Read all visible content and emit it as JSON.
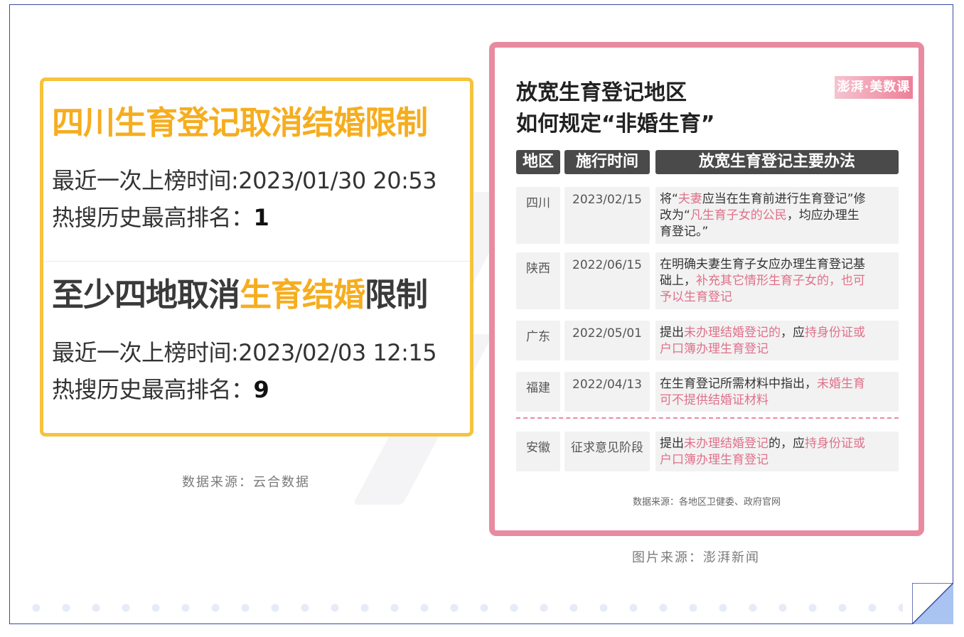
{
  "left_card": {
    "topics": [
      {
        "title_segments": [
          {
            "text": "四川生育登记取消结婚限制",
            "style": "orange"
          }
        ],
        "latest_time_label": "最近一次上榜时间:",
        "latest_time": "2023/01/30 20:53",
        "rank_label": "热搜历史最高排名：",
        "rank": "1"
      },
      {
        "title_segments": [
          {
            "text": "至少四地取消",
            "style": "dark"
          },
          {
            "text": "生育结婚",
            "style": "orange"
          },
          {
            "text": "限制",
            "style": "dark"
          }
        ],
        "latest_time_label": "最近一次上榜时间:",
        "latest_time": "2023/02/03 12:15",
        "rank_label": "热搜历史最高排名：",
        "rank": "9"
      }
    ],
    "caption": "数据来源：云合数据"
  },
  "right_card": {
    "title_line1": "放宽生育登记地区",
    "title_line2": "如何规定“非婚生育”",
    "brand": "澎湃·美数课",
    "headers": [
      "地区",
      "施行时间",
      "放宽生育登记主要办法"
    ],
    "rows": [
      {
        "region": "四川",
        "date": "2023/02/15",
        "lines": [
          [
            {
              "t": "将“",
              "p": false
            },
            {
              "t": "夫妻",
              "p": true
            },
            {
              "t": "应当在生育前进行生育登记”修",
              "p": false
            }
          ],
          [
            {
              "t": "改为“",
              "p": false
            },
            {
              "t": "凡生育子女的公民",
              "p": true
            },
            {
              "t": "，均应办理生",
              "p": false
            }
          ],
          [
            {
              "t": "育登记。”",
              "p": false
            }
          ]
        ]
      },
      {
        "region": "陕西",
        "date": "2022/06/15",
        "lines": [
          [
            {
              "t": "在明确夫妻生育子女应办理生育登记基",
              "p": false
            }
          ],
          [
            {
              "t": "础上，",
              "p": false
            },
            {
              "t": "补充其它情形生育子女的，也可",
              "p": true
            }
          ],
          [
            {
              "t": "予以生育登记",
              "p": true
            }
          ]
        ]
      },
      {
        "region": "广东",
        "date": "2022/05/01",
        "lines": [
          [
            {
              "t": "提出",
              "p": false
            },
            {
              "t": "未办理结婚登记的",
              "p": true
            },
            {
              "t": "，应",
              "p": false
            },
            {
              "t": "持身份证或",
              "p": true
            }
          ],
          [
            {
              "t": "户口簿办理生育登记",
              "p": true
            }
          ]
        ]
      },
      {
        "region": "福建",
        "date": "2022/04/13",
        "lines": [
          [
            {
              "t": "在生育登记所需材料中指出，",
              "p": false
            },
            {
              "t": "未婚生育",
              "p": true
            }
          ],
          [
            {
              "t": "可不提供结婚证材料",
              "p": true
            }
          ]
        ]
      },
      {
        "region": "安徽",
        "date": "征求意见阶段",
        "lines": [
          [
            {
              "t": "提出",
              "p": false
            },
            {
              "t": "未办理结婚登记",
              "p": true
            },
            {
              "t": "的，应",
              "p": false
            },
            {
              "t": "持身份证或",
              "p": true
            }
          ],
          [
            {
              "t": "户口簿办理生育登记",
              "p": true
            }
          ]
        ]
      }
    ],
    "source": "数据来源：各地区卫健委、政府官网",
    "caption": "图片来源：澎湃新闻"
  },
  "colors": {
    "frame": "#3b4aa0",
    "orange": "#f6ad1e",
    "yellow_border": "#f6c33c",
    "pink": "#e0708a",
    "pink_border": "#e88ba0",
    "header_bg": "#4a4a4a"
  }
}
